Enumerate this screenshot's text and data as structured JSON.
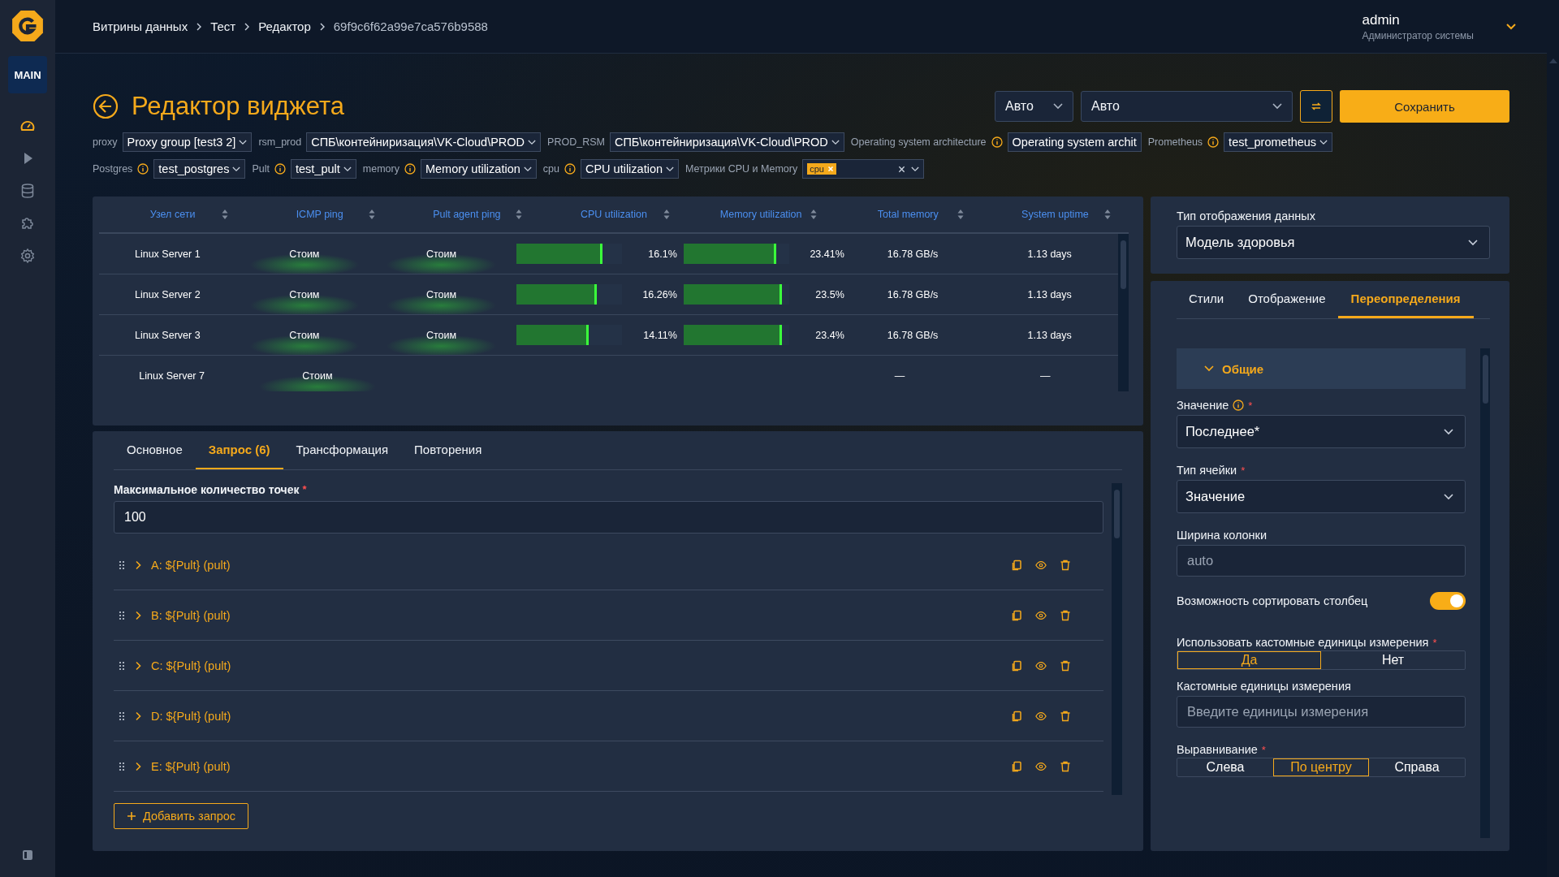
{
  "sidebar": {
    "badge": "MAIN",
    "items": [
      {
        "kind": "gauge",
        "selected": true
      },
      {
        "kind": "play",
        "selected": false
      },
      {
        "kind": "database",
        "selected": false
      },
      {
        "kind": "puzzle",
        "selected": false
      },
      {
        "kind": "gear",
        "selected": false
      }
    ]
  },
  "breadcrumbs": [
    "Витрины данных",
    "Тест",
    "Редактор",
    "69f9c6f62a99e7ca576b9588"
  ],
  "user": {
    "name": "admin",
    "role": "Администратор системы"
  },
  "page_title": "Редактор виджета",
  "header_controls": {
    "interval": "Авто",
    "range": "Авто",
    "save": "Сохранить"
  },
  "variable_rows": [
    [
      {
        "label": "proxy",
        "info": false,
        "kind": "select",
        "value": "Proxy group [test3 2]"
      },
      {
        "label": "rsm_prod",
        "info": false,
        "kind": "select",
        "value": "СПБ\\контейниризация\\VK-Cloud\\PROD"
      },
      {
        "label": "PROD_RSM",
        "info": false,
        "kind": "select",
        "value": "СПБ\\контейниризация\\VK-Cloud\\PROD"
      },
      {
        "label": "Operating system architecture",
        "info": true,
        "kind": "text",
        "value": "Operating system archit"
      },
      {
        "label": "Prometheus",
        "info": true,
        "kind": "select",
        "value": "test_prometheus"
      }
    ],
    [
      {
        "label": "Postgres",
        "info": true,
        "kind": "select",
        "value": "test_postgres"
      },
      {
        "label": "Pult",
        "info": true,
        "kind": "select",
        "value": "test_pult"
      },
      {
        "label": "memory",
        "info": true,
        "kind": "select",
        "value": "Memory utilization"
      },
      {
        "label": "cpu",
        "info": true,
        "kind": "select",
        "value": "CPU utilization"
      },
      {
        "label": "Метрики CPU и Memory",
        "info": false,
        "kind": "multi",
        "tags": [
          "cpu"
        ]
      }
    ]
  ],
  "table": {
    "columns": [
      "Узел сети",
      "ICMP ping",
      "Pult agent ping",
      "CPU utilization",
      "Memory utilization",
      "Total memory",
      "System uptime"
    ],
    "rows": [
      {
        "node": "Linux Server 1",
        "icmp": "Стоим",
        "pult_ping": "Стоим",
        "cpu": {
          "level": 0.82,
          "reading": "16.1%"
        },
        "memory": {
          "level": 0.88,
          "reading": "23.41%"
        },
        "total_memory": "16.78 GB/s",
        "uptime": "1.13 days"
      },
      {
        "node": "Linux Server 2",
        "icmp": "Стоим",
        "pult_ping": "Стоим",
        "cpu": {
          "level": 0.76,
          "reading": "16.26%"
        },
        "memory": {
          "level": 0.93,
          "reading": "23.5%"
        },
        "total_memory": "16.78 GB/s",
        "uptime": "1.13 days"
      },
      {
        "node": "Linux Server 3",
        "icmp": "Стоим",
        "pult_ping": "Стоим",
        "cpu": {
          "level": 0.69,
          "reading": "14.11%"
        },
        "memory": {
          "level": 0.93,
          "reading": "23.4%"
        },
        "total_memory": "16.78 GB/s",
        "uptime": "1.13 days"
      },
      {
        "node": "Linux Server 7",
        "icmp": "Стоим",
        "total_memory": "—",
        "uptime": "—"
      }
    ]
  },
  "editor_tabs": [
    {
      "label": "Основное",
      "selected": false
    },
    {
      "label": "Запрос (6)",
      "selected": true
    },
    {
      "label": "Трансформация",
      "selected": false
    },
    {
      "label": "Повторения",
      "selected": false
    }
  ],
  "max_points": {
    "label": "Максимальное количество точек",
    "required_mark": "*",
    "value": "100"
  },
  "queries": [
    "A: ${Pult} (pult)",
    "B: ${Pult} (pult)",
    "C: ${Pult} (pult)",
    "D: ${Pult} (pult)",
    "E: ${Pult} (pult)"
  ],
  "add_query": "Добавить запрос",
  "display_type": {
    "label": "Тип отображения данных",
    "value": "Модель здоровья"
  },
  "settings_tabs": [
    {
      "label": "Стили",
      "selected": false
    },
    {
      "label": "Отображение",
      "selected": false
    },
    {
      "label": "Переопределения",
      "selected": true
    }
  ],
  "section": {
    "title": "Общие",
    "expanded": true
  },
  "fields": [
    {
      "kind": "select",
      "label": "Значение",
      "info": true,
      "required_mark": "*",
      "value": "Последнее*"
    },
    {
      "kind": "select",
      "label": "Тип ячейки",
      "info": false,
      "required_mark": "*",
      "value": "Значение"
    },
    {
      "kind": "input",
      "label": "Ширина колонки",
      "info": false,
      "placeholder": "auto"
    },
    {
      "kind": "toggle",
      "label": "Возможность сортировать столбец",
      "on": true
    },
    {
      "kind": "segmented",
      "label": "Использовать кастомные единицы измерения",
      "info": false,
      "required_mark": "*",
      "options": [
        {
          "label": "Да",
          "selected": true
        },
        {
          "label": "Нет",
          "selected": false
        }
      ]
    },
    {
      "kind": "input",
      "label": "Кастомные единицы измерения",
      "info": false,
      "placeholder": "Введите единицы измерения"
    },
    {
      "kind": "segmented",
      "label": "Выравнивание",
      "info": false,
      "required_mark": "*",
      "options": [
        {
          "label": "Слева",
          "selected": false
        },
        {
          "label": "По центру",
          "selected": true
        },
        {
          "label": "Справа",
          "selected": false
        }
      ]
    }
  ]
}
